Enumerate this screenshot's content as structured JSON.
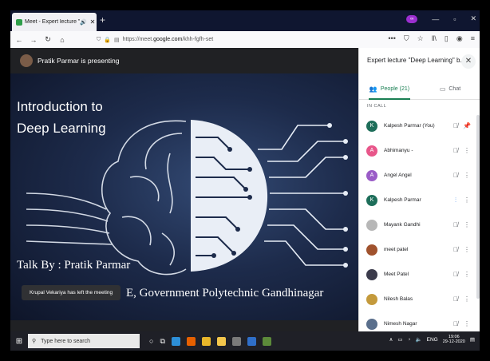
{
  "browser": {
    "tab_title": "Meet - Expert lecture \"Deep",
    "url_prefix": "https://meet.",
    "url_host": "google.com",
    "url_path": "/khh-fgfh-set"
  },
  "meet": {
    "presenting_text": "Pratik Parmar is presenting",
    "slide_title_line1": "Introduction to",
    "slide_title_line2": "Deep Learning",
    "talk_by": "Talk By : Pratik Parmar",
    "college": "E, Government Polytechnic Gandhinagar",
    "toast": "Krupal Vekariya has left the meeting"
  },
  "panel": {
    "heading": "Expert lecture \"Deep Learning\" b...",
    "tab_people": "People (21)",
    "tab_chat": "Chat",
    "section_label": "IN CALL",
    "people": [
      {
        "initial": "K",
        "name": "Kalpesh Parmar (You)",
        "color": "#1e6e5a"
      },
      {
        "initial": "A",
        "name": "Abhimanyu -",
        "color": "#e8568a"
      },
      {
        "initial": "A",
        "name": "Angel Angel",
        "color": "#9a5cc7"
      },
      {
        "initial": "K",
        "name": "Kalpesh Parmar",
        "color": "#1e6e5a"
      },
      {
        "initial": "",
        "name": "Mayank Gandhi",
        "color": "#b7b7b7"
      },
      {
        "initial": "",
        "name": "meet patel",
        "color": "#a0522d"
      },
      {
        "initial": "",
        "name": "Meet Patel",
        "color": "#3c3c4c"
      },
      {
        "initial": "",
        "name": "Nilesh Balas",
        "color": "#c49a3c"
      },
      {
        "initial": "",
        "name": "Nimesh Nagar",
        "color": "#5a6f8c"
      }
    ]
  },
  "taskbar": {
    "search_placeholder": "Type here to search",
    "lang": "ENG",
    "time": "19:06",
    "date": "29-12-2020"
  }
}
